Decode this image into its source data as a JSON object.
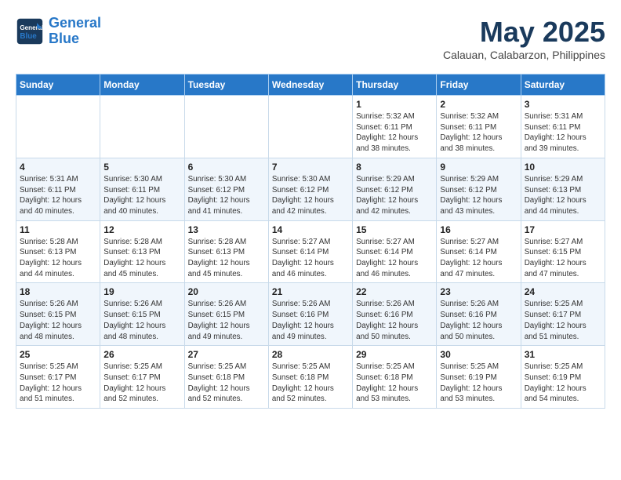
{
  "logo": {
    "line1": "General",
    "line2": "Blue"
  },
  "title": "May 2025",
  "subtitle": "Calauan, Calabarzon, Philippines",
  "days_of_week": [
    "Sunday",
    "Monday",
    "Tuesday",
    "Wednesday",
    "Thursday",
    "Friday",
    "Saturday"
  ],
  "weeks": [
    [
      {
        "day": "",
        "info": ""
      },
      {
        "day": "",
        "info": ""
      },
      {
        "day": "",
        "info": ""
      },
      {
        "day": "",
        "info": ""
      },
      {
        "day": "1",
        "info": "Sunrise: 5:32 AM\nSunset: 6:11 PM\nDaylight: 12 hours\nand 38 minutes."
      },
      {
        "day": "2",
        "info": "Sunrise: 5:32 AM\nSunset: 6:11 PM\nDaylight: 12 hours\nand 38 minutes."
      },
      {
        "day": "3",
        "info": "Sunrise: 5:31 AM\nSunset: 6:11 PM\nDaylight: 12 hours\nand 39 minutes."
      }
    ],
    [
      {
        "day": "4",
        "info": "Sunrise: 5:31 AM\nSunset: 6:11 PM\nDaylight: 12 hours\nand 40 minutes."
      },
      {
        "day": "5",
        "info": "Sunrise: 5:30 AM\nSunset: 6:11 PM\nDaylight: 12 hours\nand 40 minutes."
      },
      {
        "day": "6",
        "info": "Sunrise: 5:30 AM\nSunset: 6:12 PM\nDaylight: 12 hours\nand 41 minutes."
      },
      {
        "day": "7",
        "info": "Sunrise: 5:30 AM\nSunset: 6:12 PM\nDaylight: 12 hours\nand 42 minutes."
      },
      {
        "day": "8",
        "info": "Sunrise: 5:29 AM\nSunset: 6:12 PM\nDaylight: 12 hours\nand 42 minutes."
      },
      {
        "day": "9",
        "info": "Sunrise: 5:29 AM\nSunset: 6:12 PM\nDaylight: 12 hours\nand 43 minutes."
      },
      {
        "day": "10",
        "info": "Sunrise: 5:29 AM\nSunset: 6:13 PM\nDaylight: 12 hours\nand 44 minutes."
      }
    ],
    [
      {
        "day": "11",
        "info": "Sunrise: 5:28 AM\nSunset: 6:13 PM\nDaylight: 12 hours\nand 44 minutes."
      },
      {
        "day": "12",
        "info": "Sunrise: 5:28 AM\nSunset: 6:13 PM\nDaylight: 12 hours\nand 45 minutes."
      },
      {
        "day": "13",
        "info": "Sunrise: 5:28 AM\nSunset: 6:13 PM\nDaylight: 12 hours\nand 45 minutes."
      },
      {
        "day": "14",
        "info": "Sunrise: 5:27 AM\nSunset: 6:14 PM\nDaylight: 12 hours\nand 46 minutes."
      },
      {
        "day": "15",
        "info": "Sunrise: 5:27 AM\nSunset: 6:14 PM\nDaylight: 12 hours\nand 46 minutes."
      },
      {
        "day": "16",
        "info": "Sunrise: 5:27 AM\nSunset: 6:14 PM\nDaylight: 12 hours\nand 47 minutes."
      },
      {
        "day": "17",
        "info": "Sunrise: 5:27 AM\nSunset: 6:15 PM\nDaylight: 12 hours\nand 47 minutes."
      }
    ],
    [
      {
        "day": "18",
        "info": "Sunrise: 5:26 AM\nSunset: 6:15 PM\nDaylight: 12 hours\nand 48 minutes."
      },
      {
        "day": "19",
        "info": "Sunrise: 5:26 AM\nSunset: 6:15 PM\nDaylight: 12 hours\nand 48 minutes."
      },
      {
        "day": "20",
        "info": "Sunrise: 5:26 AM\nSunset: 6:15 PM\nDaylight: 12 hours\nand 49 minutes."
      },
      {
        "day": "21",
        "info": "Sunrise: 5:26 AM\nSunset: 6:16 PM\nDaylight: 12 hours\nand 49 minutes."
      },
      {
        "day": "22",
        "info": "Sunrise: 5:26 AM\nSunset: 6:16 PM\nDaylight: 12 hours\nand 50 minutes."
      },
      {
        "day": "23",
        "info": "Sunrise: 5:26 AM\nSunset: 6:16 PM\nDaylight: 12 hours\nand 50 minutes."
      },
      {
        "day": "24",
        "info": "Sunrise: 5:25 AM\nSunset: 6:17 PM\nDaylight: 12 hours\nand 51 minutes."
      }
    ],
    [
      {
        "day": "25",
        "info": "Sunrise: 5:25 AM\nSunset: 6:17 PM\nDaylight: 12 hours\nand 51 minutes."
      },
      {
        "day": "26",
        "info": "Sunrise: 5:25 AM\nSunset: 6:17 PM\nDaylight: 12 hours\nand 52 minutes."
      },
      {
        "day": "27",
        "info": "Sunrise: 5:25 AM\nSunset: 6:18 PM\nDaylight: 12 hours\nand 52 minutes."
      },
      {
        "day": "28",
        "info": "Sunrise: 5:25 AM\nSunset: 6:18 PM\nDaylight: 12 hours\nand 52 minutes."
      },
      {
        "day": "29",
        "info": "Sunrise: 5:25 AM\nSunset: 6:18 PM\nDaylight: 12 hours\nand 53 minutes."
      },
      {
        "day": "30",
        "info": "Sunrise: 5:25 AM\nSunset: 6:19 PM\nDaylight: 12 hours\nand 53 minutes."
      },
      {
        "day": "31",
        "info": "Sunrise: 5:25 AM\nSunset: 6:19 PM\nDaylight: 12 hours\nand 54 minutes."
      }
    ]
  ]
}
